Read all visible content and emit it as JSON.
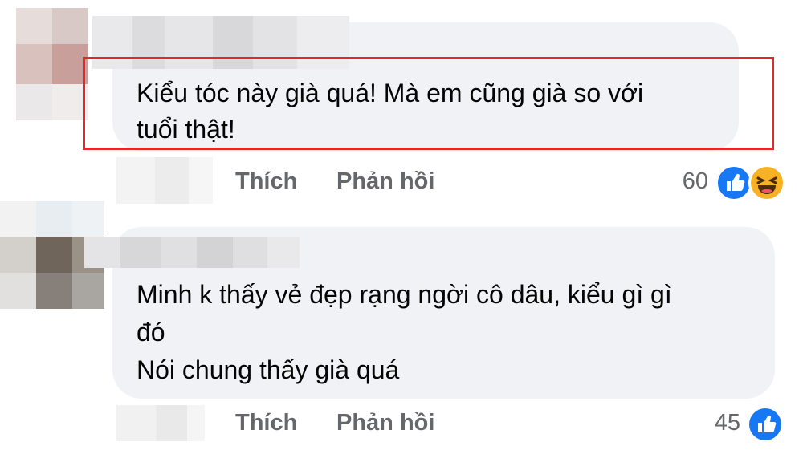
{
  "comments": [
    {
      "text_lines": [
        "Kiểu tóc này già quá! Mà em cũng già so với",
        "tuổi thật!"
      ],
      "like_label": "Thích",
      "reply_label": "Phản hồi",
      "reaction_count": "60",
      "reactions": [
        "like-icon",
        "haha-icon"
      ]
    },
    {
      "text_lines": [
        "Minh k thấy vẻ đẹp rạng ngời cô dâu, kiểu gì gì",
        "đó",
        "Nói chung thấy già quá"
      ],
      "like_label": "Thích",
      "reply_label": "Phản hồi",
      "reaction_count": "45",
      "reactions": [
        "like-icon"
      ]
    }
  ],
  "colors": {
    "bubble": "#f0f2f5",
    "action_text": "#65676b",
    "like_blue": "#1877f2",
    "haha_yellow": "#f7b125",
    "highlight_red": "#e0292b"
  }
}
